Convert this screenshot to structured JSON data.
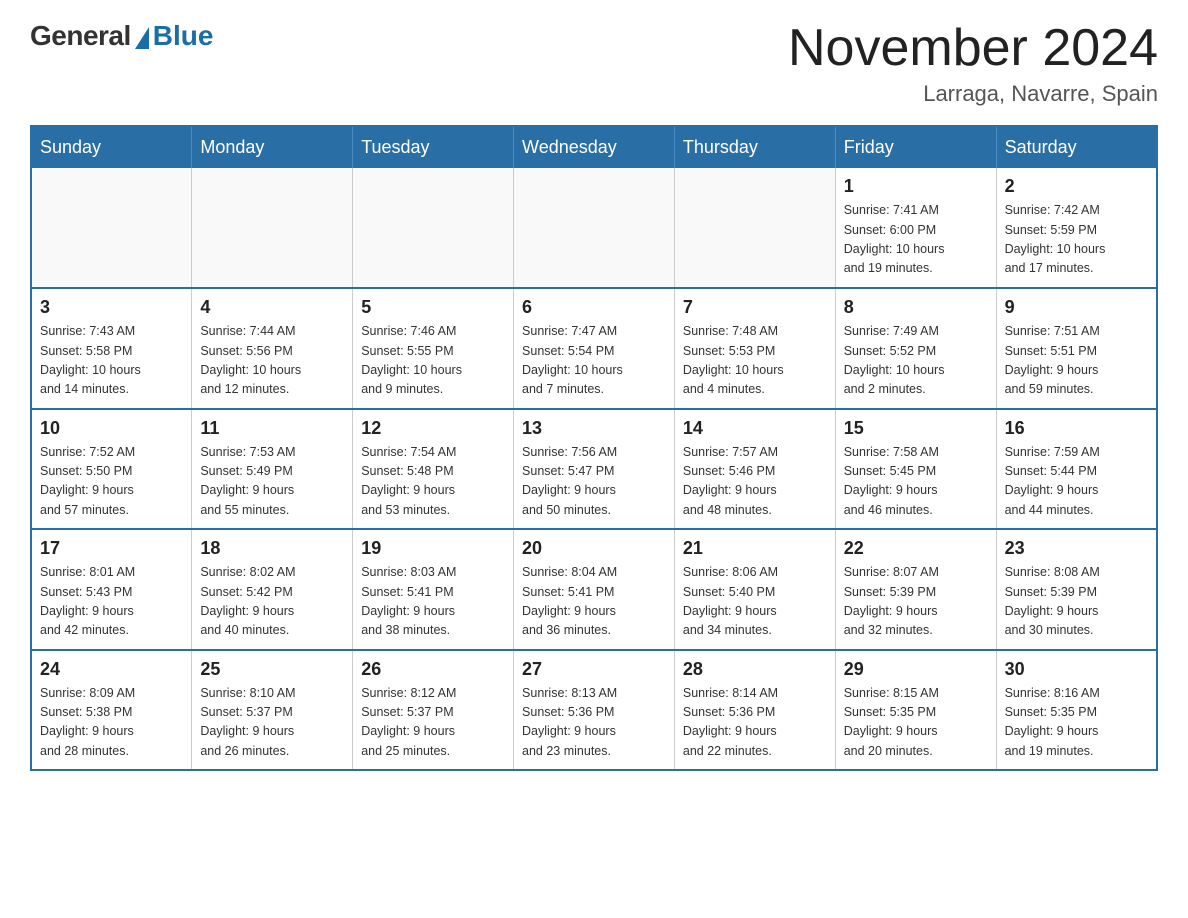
{
  "header": {
    "logo_general": "General",
    "logo_blue": "Blue",
    "month_title": "November 2024",
    "location": "Larraga, Navarre, Spain"
  },
  "weekdays": [
    "Sunday",
    "Monday",
    "Tuesday",
    "Wednesday",
    "Thursday",
    "Friday",
    "Saturday"
  ],
  "weeks": [
    [
      {
        "day": "",
        "info": ""
      },
      {
        "day": "",
        "info": ""
      },
      {
        "day": "",
        "info": ""
      },
      {
        "day": "",
        "info": ""
      },
      {
        "day": "",
        "info": ""
      },
      {
        "day": "1",
        "info": "Sunrise: 7:41 AM\nSunset: 6:00 PM\nDaylight: 10 hours\nand 19 minutes."
      },
      {
        "day": "2",
        "info": "Sunrise: 7:42 AM\nSunset: 5:59 PM\nDaylight: 10 hours\nand 17 minutes."
      }
    ],
    [
      {
        "day": "3",
        "info": "Sunrise: 7:43 AM\nSunset: 5:58 PM\nDaylight: 10 hours\nand 14 minutes."
      },
      {
        "day": "4",
        "info": "Sunrise: 7:44 AM\nSunset: 5:56 PM\nDaylight: 10 hours\nand 12 minutes."
      },
      {
        "day": "5",
        "info": "Sunrise: 7:46 AM\nSunset: 5:55 PM\nDaylight: 10 hours\nand 9 minutes."
      },
      {
        "day": "6",
        "info": "Sunrise: 7:47 AM\nSunset: 5:54 PM\nDaylight: 10 hours\nand 7 minutes."
      },
      {
        "day": "7",
        "info": "Sunrise: 7:48 AM\nSunset: 5:53 PM\nDaylight: 10 hours\nand 4 minutes."
      },
      {
        "day": "8",
        "info": "Sunrise: 7:49 AM\nSunset: 5:52 PM\nDaylight: 10 hours\nand 2 minutes."
      },
      {
        "day": "9",
        "info": "Sunrise: 7:51 AM\nSunset: 5:51 PM\nDaylight: 9 hours\nand 59 minutes."
      }
    ],
    [
      {
        "day": "10",
        "info": "Sunrise: 7:52 AM\nSunset: 5:50 PM\nDaylight: 9 hours\nand 57 minutes."
      },
      {
        "day": "11",
        "info": "Sunrise: 7:53 AM\nSunset: 5:49 PM\nDaylight: 9 hours\nand 55 minutes."
      },
      {
        "day": "12",
        "info": "Sunrise: 7:54 AM\nSunset: 5:48 PM\nDaylight: 9 hours\nand 53 minutes."
      },
      {
        "day": "13",
        "info": "Sunrise: 7:56 AM\nSunset: 5:47 PM\nDaylight: 9 hours\nand 50 minutes."
      },
      {
        "day": "14",
        "info": "Sunrise: 7:57 AM\nSunset: 5:46 PM\nDaylight: 9 hours\nand 48 minutes."
      },
      {
        "day": "15",
        "info": "Sunrise: 7:58 AM\nSunset: 5:45 PM\nDaylight: 9 hours\nand 46 minutes."
      },
      {
        "day": "16",
        "info": "Sunrise: 7:59 AM\nSunset: 5:44 PM\nDaylight: 9 hours\nand 44 minutes."
      }
    ],
    [
      {
        "day": "17",
        "info": "Sunrise: 8:01 AM\nSunset: 5:43 PM\nDaylight: 9 hours\nand 42 minutes."
      },
      {
        "day": "18",
        "info": "Sunrise: 8:02 AM\nSunset: 5:42 PM\nDaylight: 9 hours\nand 40 minutes."
      },
      {
        "day": "19",
        "info": "Sunrise: 8:03 AM\nSunset: 5:41 PM\nDaylight: 9 hours\nand 38 minutes."
      },
      {
        "day": "20",
        "info": "Sunrise: 8:04 AM\nSunset: 5:41 PM\nDaylight: 9 hours\nand 36 minutes."
      },
      {
        "day": "21",
        "info": "Sunrise: 8:06 AM\nSunset: 5:40 PM\nDaylight: 9 hours\nand 34 minutes."
      },
      {
        "day": "22",
        "info": "Sunrise: 8:07 AM\nSunset: 5:39 PM\nDaylight: 9 hours\nand 32 minutes."
      },
      {
        "day": "23",
        "info": "Sunrise: 8:08 AM\nSunset: 5:39 PM\nDaylight: 9 hours\nand 30 minutes."
      }
    ],
    [
      {
        "day": "24",
        "info": "Sunrise: 8:09 AM\nSunset: 5:38 PM\nDaylight: 9 hours\nand 28 minutes."
      },
      {
        "day": "25",
        "info": "Sunrise: 8:10 AM\nSunset: 5:37 PM\nDaylight: 9 hours\nand 26 minutes."
      },
      {
        "day": "26",
        "info": "Sunrise: 8:12 AM\nSunset: 5:37 PM\nDaylight: 9 hours\nand 25 minutes."
      },
      {
        "day": "27",
        "info": "Sunrise: 8:13 AM\nSunset: 5:36 PM\nDaylight: 9 hours\nand 23 minutes."
      },
      {
        "day": "28",
        "info": "Sunrise: 8:14 AM\nSunset: 5:36 PM\nDaylight: 9 hours\nand 22 minutes."
      },
      {
        "day": "29",
        "info": "Sunrise: 8:15 AM\nSunset: 5:35 PM\nDaylight: 9 hours\nand 20 minutes."
      },
      {
        "day": "30",
        "info": "Sunrise: 8:16 AM\nSunset: 5:35 PM\nDaylight: 9 hours\nand 19 minutes."
      }
    ]
  ]
}
